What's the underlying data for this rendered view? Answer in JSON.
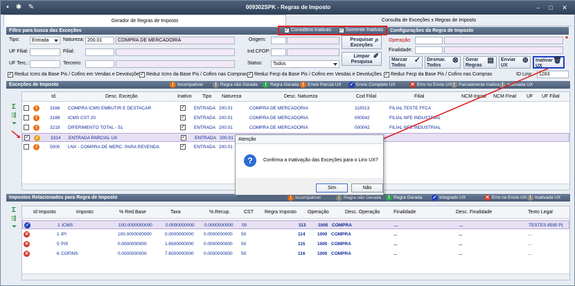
{
  "window": {
    "title": "009302SPK - Regras de Imposto"
  },
  "tabs": {
    "gerador": "Gerador de Regras de Imposto",
    "consulta": "Consulta de Exceções x Regras de Imposto"
  },
  "filtro": {
    "title": "Filtro para busca das Exceções",
    "considera_inativas": "Considera Inativas",
    "somente_inativas": "Somente Inativas",
    "tipo_label": "Tipo:",
    "tipo_value": "Entrada",
    "natureza_label": "Natureza:",
    "natureza_code": "200.01",
    "natureza_desc": "COMPRA DE MERCADORIA",
    "origem_label": "Origem:",
    "uf_filial_label": "UF Filial:",
    "filial_label": "Filial:",
    "ind_cfop_label": "Ind.CFOP:",
    "uf_terc_label": "UF Terc.:",
    "terceiro_label": "Terceiro:",
    "status_label": "Status:",
    "status_value": "Todos",
    "pesquisar": "Pesquisar Exceções",
    "limpar": "Limpar Pesquisa"
  },
  "config": {
    "title": "Configurações da Regra de Imposto",
    "operacao_label": "Operação:",
    "finalidade_label": "Finalidade:",
    "marcar": "Marcar Todos",
    "desmarcar": "Desmar. Todos",
    "gerar": "Gerar Regras",
    "enviar": "Enviar UX",
    "inativar": "Inativar UX",
    "id_linx_label": "ID Linx:",
    "id_linx_value": "1283"
  },
  "options": [
    "Reduz Icms da Base Pis / Cofins em Vendas e Devoluções",
    "Reduz Icms da Base Pis / Cofins nas Compras",
    "Reduz Fecp da Base Pis / Cofins em Vendas e Devoluções",
    "Reduz Fecp da Base Pis / Cofins nas Compras"
  ],
  "excecoes": {
    "title": "Exceções de Imposto",
    "legend": [
      "Incompatível",
      "Regra não Gerada",
      "Regra Gerada",
      "Envio Parcial UX",
      "Envio Completo UX",
      "Erro no Envio UX",
      "Parcialmente Inativa",
      "Inativada UX"
    ],
    "headers": [
      "Id.",
      "Desc. Exceção",
      "Inativo",
      "Tipo",
      "Natureza",
      "Desc. Natureza",
      "Cod Filial",
      "Filial",
      "NCM Inicial",
      "NCM Final",
      "UF",
      "UF Filial"
    ],
    "rows": [
      {
        "status": "orange",
        "id": "3166",
        "desc": "COMPRA ICMS EMBUTIR E DESTACAR",
        "tipo": "ENTRADA",
        "nat": "200.01",
        "desc_nat": "COMPRA DE MERCADORIA",
        "cod": "110013",
        "filial": "FILIAL TESTE FFCA"
      },
      {
        "status": "orange",
        "id": "3188",
        "desc": "ICMS  CST 20",
        "tipo": "ENTRADA",
        "nat": "200.01",
        "desc_nat": "COMPRA DE MERCADORIA",
        "cod": "000042",
        "filial": "FILIAL NFE INDUSTRIAL"
      },
      {
        "status": "orange",
        "id": "3219",
        "desc": "DIFERIMENTO TOTAL - 51",
        "tipo": "ENTRADA",
        "nat": "200.01",
        "desc_nat": "COMPRA DE MERCADORIA",
        "cod": "000042",
        "filial": "FILIAL NFE INDUSTRIAL"
      },
      {
        "status": "yellow",
        "id": "3314",
        "desc": "ENTRADA PARCIAL UX",
        "tipo": "ENTRADA",
        "nat": "200.01",
        "desc_nat": "",
        "cod": "",
        "filial": ""
      },
      {
        "status": "orange",
        "id": "5000",
        "desc": "LNX - COMPRA DE MERC. PARA REVENDA",
        "tipo": "ENTRADA",
        "nat": "200.01",
        "desc_nat": "",
        "cod": "",
        "filial": ""
      }
    ]
  },
  "dialog": {
    "title": "Atenção",
    "message": "Confirma a Inativação das Exceções para o Linx UX?",
    "sim": "Sim",
    "nao": "Não"
  },
  "impostos": {
    "title": "Impostos Relacionados para Regra de Imposto",
    "legend": [
      "Incompatível",
      "Regra não Gerada",
      "Regra Gerada",
      "Integrado UX",
      "Erro no Envio UX",
      "Inativada UX"
    ],
    "headers": [
      "Id Imposto",
      "Imposto",
      "% Red.Base",
      "Taxa",
      "%.Recup.",
      "CST",
      "Regra Imposto",
      "Operação",
      "Desc. Operação",
      "Finalidade",
      "Desc. Finalidade",
      "Texto Legal"
    ],
    "rows": [
      {
        "status": "blue",
        "id": "1",
        "imp": "ICMS",
        "red": "100.0000000000",
        "taxa": "0.0000000000",
        "rec": "0.0000000000",
        "cst": "00",
        "regra": "113",
        "op": "1000",
        "desc_op": "COMPRA",
        "fin": "...",
        "desc_fin": "...",
        "texto": "TESTES 8590 P("
      },
      {
        "status": "red",
        "id": "1",
        "imp": "IPI",
        "red": "100.0000000000",
        "taxa": "0.0000000000",
        "rec": "0.0000000000",
        "cst": "50",
        "regra": "114",
        "op": "1000",
        "desc_op": "COMPRA",
        "fin": "...",
        "desc_fin": "...",
        "texto": "..."
      },
      {
        "status": "red",
        "id": "5",
        "imp": "PIS",
        "red": "0.0000000000",
        "taxa": "1.6500000000",
        "rec": "0.0000000000",
        "cst": "50",
        "regra": "115",
        "op": "1000",
        "desc_op": "COMPRA",
        "fin": "...",
        "desc_fin": "...",
        "texto": "..."
      },
      {
        "status": "red",
        "id": "6",
        "imp": "COFINS",
        "red": "0.0000000000",
        "taxa": "7.6000000000",
        "rec": "0.0000000000",
        "cst": "50",
        "regra": "116",
        "op": "1000",
        "desc_op": "COMPRA",
        "fin": "...",
        "desc_fin": "...",
        "texto": "..."
      }
    ]
  },
  "colors": {
    "header": "#4a5c76",
    "orange": "#e8731a",
    "yellow": "#e0a21a",
    "green": "#2fa84f",
    "blue": "#1f3fbf",
    "red": "#d23a2a",
    "grey": "#8c8c8c",
    "annotation": "#e02020"
  }
}
